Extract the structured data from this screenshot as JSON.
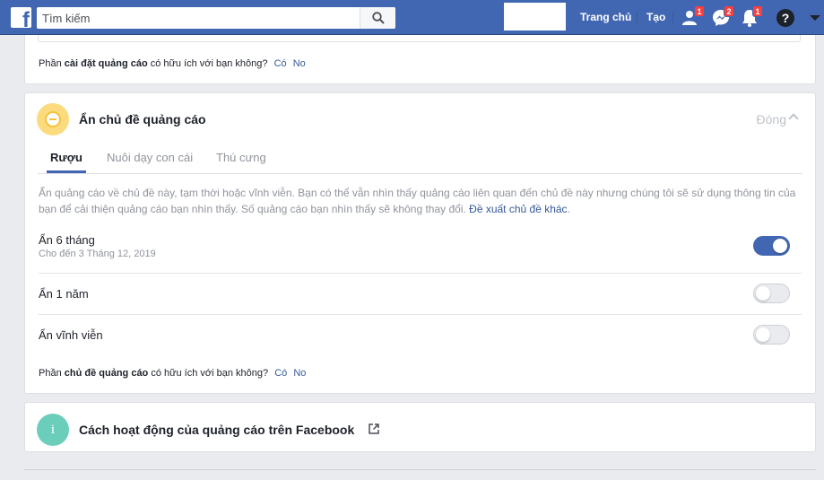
{
  "topbar": {
    "logo_icon": "facebook-logo-icon",
    "search_placeholder": "Tìm kiếm",
    "nav": {
      "home": "Trang chủ",
      "create": "Tạo"
    },
    "badges": {
      "friend_requests": "1",
      "messages": "2",
      "notifications": "1"
    },
    "brand_color": "#4267b2"
  },
  "top_card": {
    "feedback": {
      "prefix": "Phần",
      "bold": "cài đặt quảng cáo",
      "suffix": "có hữu ích với bạn không?",
      "yes": "Có",
      "no": "No"
    }
  },
  "topics_card": {
    "title": "Ẩn chủ đề quảng cáo",
    "close_label": "Đóng",
    "tabs": [
      "Rượu",
      "Nuôi dạy con cái",
      "Thú cưng"
    ],
    "active_tab": 0,
    "description": "Ẩn quảng cáo về chủ đề này, tạm thời hoặc vĩnh viễn. Bạn có thể vẫn nhìn thấy quảng cáo liên quan đến chủ đề này nhưng chúng tôi sẽ sử dụng thông tin của bạn để cải thiện quảng cáo bạn nhìn thấy. Số quảng cáo bạn nhìn thấy sẽ không thay đổi.",
    "suggest_link": "Đề xuất chủ đề khác",
    "options": [
      {
        "label": "Ẩn 6 tháng",
        "sub": "Cho đến 3 Tháng 12, 2019",
        "on": true
      },
      {
        "label": "Ẩn 1 năm",
        "sub": "",
        "on": false
      },
      {
        "label": "Ẩn vĩnh viễn",
        "sub": "",
        "on": false
      }
    ],
    "feedback": {
      "prefix": "Phần",
      "bold": "chủ đề quảng cáo",
      "suffix": "có hữu ích với bạn không?",
      "yes": "Có",
      "no": "No"
    }
  },
  "info_card": {
    "title": "Cách hoạt động của quảng cáo trên Facebook",
    "icon_letter": "i"
  }
}
